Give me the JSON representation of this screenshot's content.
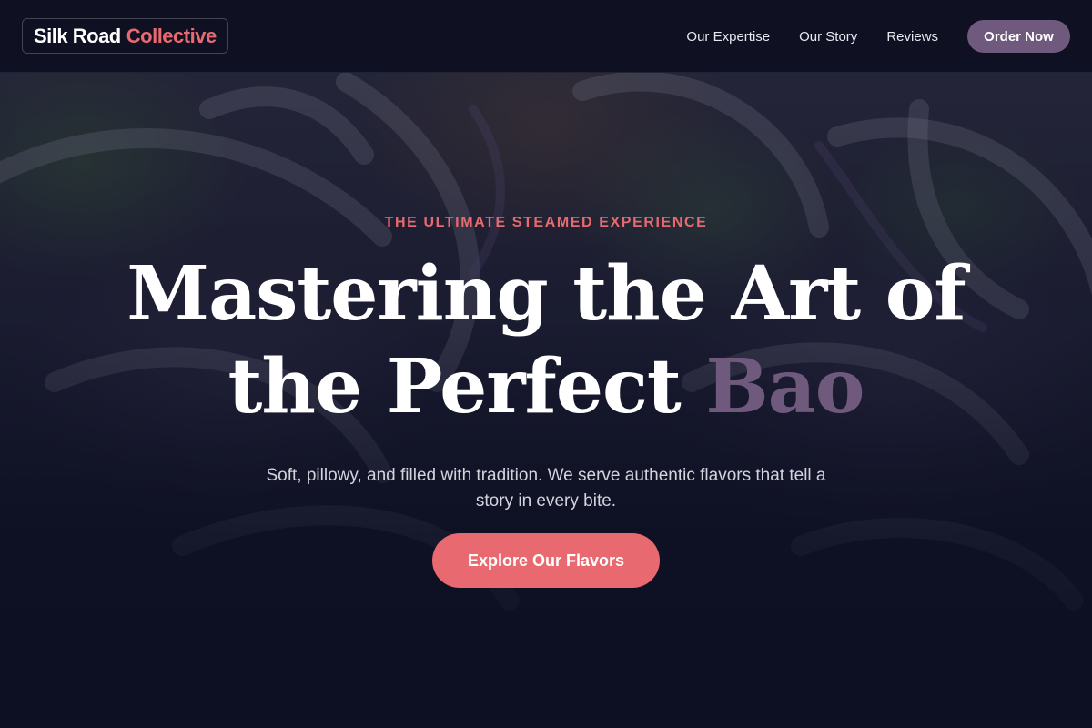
{
  "header": {
    "logo_main": "Silk Road",
    "logo_accent": "Collective",
    "nav": [
      "Our Expertise",
      "Our Story",
      "Reviews"
    ],
    "order_label": "Order Now"
  },
  "hero": {
    "eyebrow": "THE ULTIMATE STEAMED EXPERIENCE",
    "headline_line1": "Mastering the Art of",
    "headline_line2_prefix": "the Perfect",
    "headline_line2_accent": "Bao",
    "subtitle": "Soft, pillowy, and filled with tradition. We serve authentic flavors that tell a story in every bite.",
    "cta_label": "Explore Our Flavors"
  },
  "colors": {
    "background": "#0d0f22",
    "accent_coral": "#e8696f",
    "accent_purple": "#6f5a7e",
    "text_primary": "#ffffff",
    "text_secondary": "#d4d4de"
  }
}
